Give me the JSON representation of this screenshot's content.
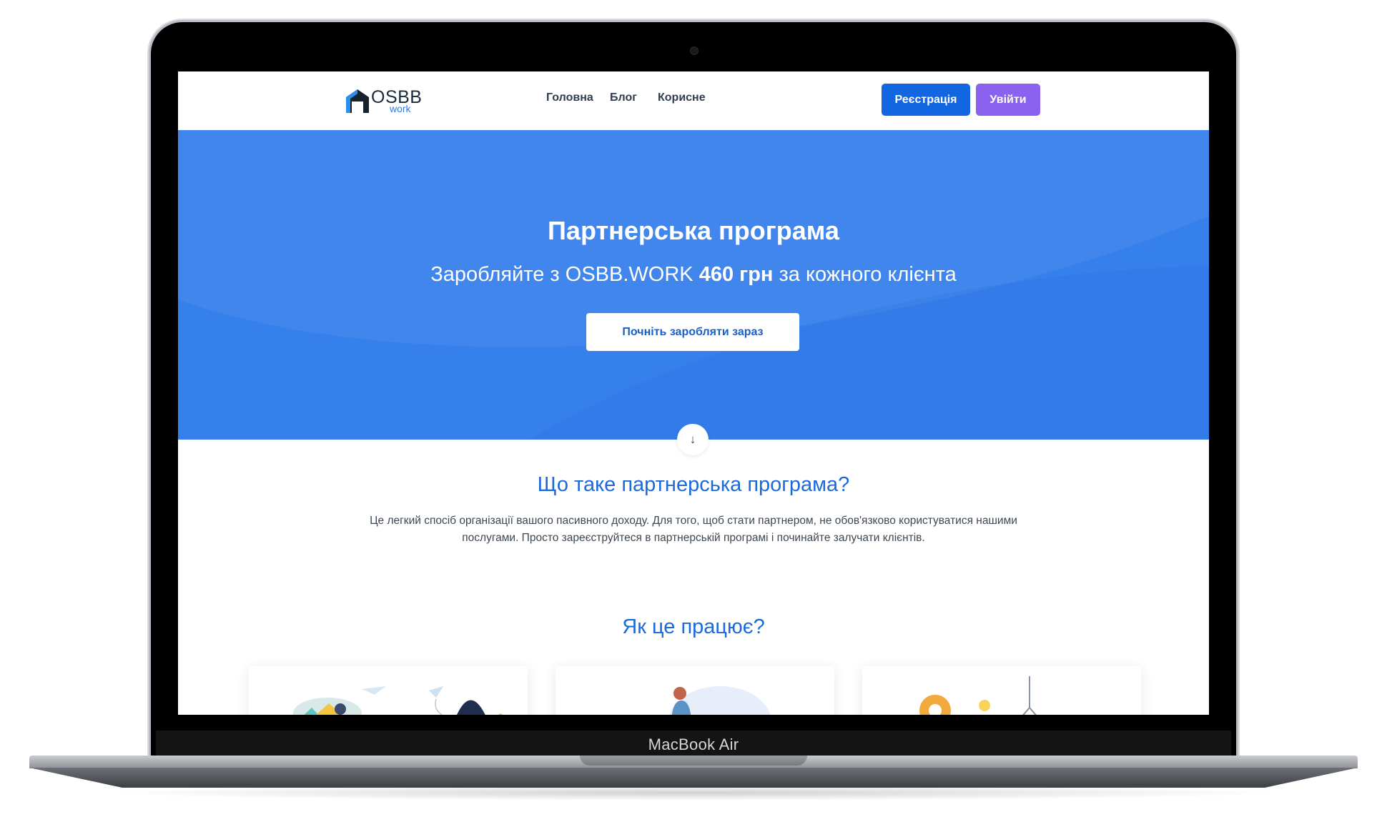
{
  "device": {
    "label": "MacBook Air"
  },
  "nav": {
    "logo": {
      "main": "OSBB",
      "sub": "work"
    },
    "links": [
      "Головна",
      "Блог",
      "Корисне"
    ],
    "register_label": "Реєстрація",
    "login_label": "Увійти"
  },
  "hero": {
    "title": "Партнерська програма",
    "subtitle_pre": "Заробляйте з OSBB.WORK ",
    "subtitle_bold": "460 грн",
    "subtitle_post": " за кожного клієнта",
    "cta_label": "Почніть заробляти зараз"
  },
  "about": {
    "title": "Що таке партнерська програма?",
    "text": "Це легкий спосіб організації вашого пасивного доходу. Для того, щоб стати партнером, не обов'язково користуватися нашими послугами. Просто зареєструйтеся в партнерській програмі і починайте залучати клієнтів."
  },
  "how": {
    "title": "Як це працює?"
  },
  "colors": {
    "hero_bg": "#3680ec",
    "primary": "#1267e0",
    "accent_purple": "#8a62ef",
    "heading_blue": "#1c6ad9"
  },
  "icons": [
    "arrow-down-icon",
    "osbb-house-logo-icon"
  ]
}
